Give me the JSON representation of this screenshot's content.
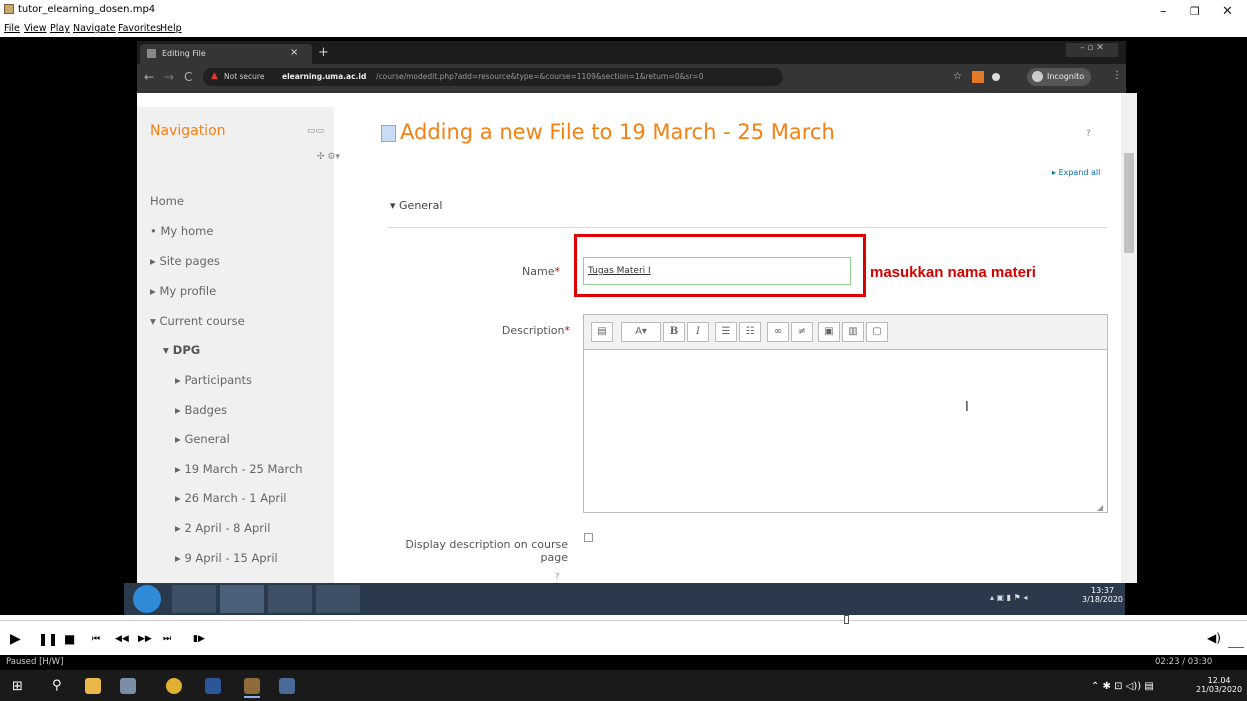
{
  "player": {
    "window_title": "tutor_elearning_dosen.mp4",
    "menu": [
      "File",
      "View",
      "Play",
      "Navigate",
      "Favorites",
      "Help"
    ],
    "status": "Paused [H/W]",
    "time": "02:23 / 03:30"
  },
  "browser": {
    "tab_title": "Editing File",
    "security_label": "Not secure",
    "url_host": "elearning.uma.ac.id",
    "url_path": "/course/modedit.php?add=resource&type=&course=1109&section=1&return=0&sr=0",
    "incognito_label": "Incognito"
  },
  "navigation": {
    "title": "Navigation",
    "items": [
      {
        "label": "Home"
      },
      {
        "label": "My home"
      },
      {
        "label": "Site pages"
      },
      {
        "label": "My profile"
      },
      {
        "label": "Current course"
      },
      {
        "label": "DPG"
      },
      {
        "label": "Participants"
      },
      {
        "label": "Badges"
      },
      {
        "label": "General"
      },
      {
        "label": "19 March - 25 March"
      },
      {
        "label": "26 March - 1 April"
      },
      {
        "label": "2 April - 8 April"
      },
      {
        "label": "9 April - 15 April"
      }
    ]
  },
  "form": {
    "heading": "Adding a new File to 19 March - 25 March",
    "expand_all": "Expand all",
    "section": "General",
    "name_label": "Name",
    "name_value": "Tugas Materi I",
    "annotation": "masukkan nama materi",
    "description_label": "Description",
    "display_desc_label_1": "Display description on course",
    "display_desc_label_2": "page"
  },
  "inner_taskbar": {
    "time": "13:37",
    "date": "3/18/2020"
  },
  "os_taskbar": {
    "time": "12.04",
    "date": "21/03/2020"
  }
}
